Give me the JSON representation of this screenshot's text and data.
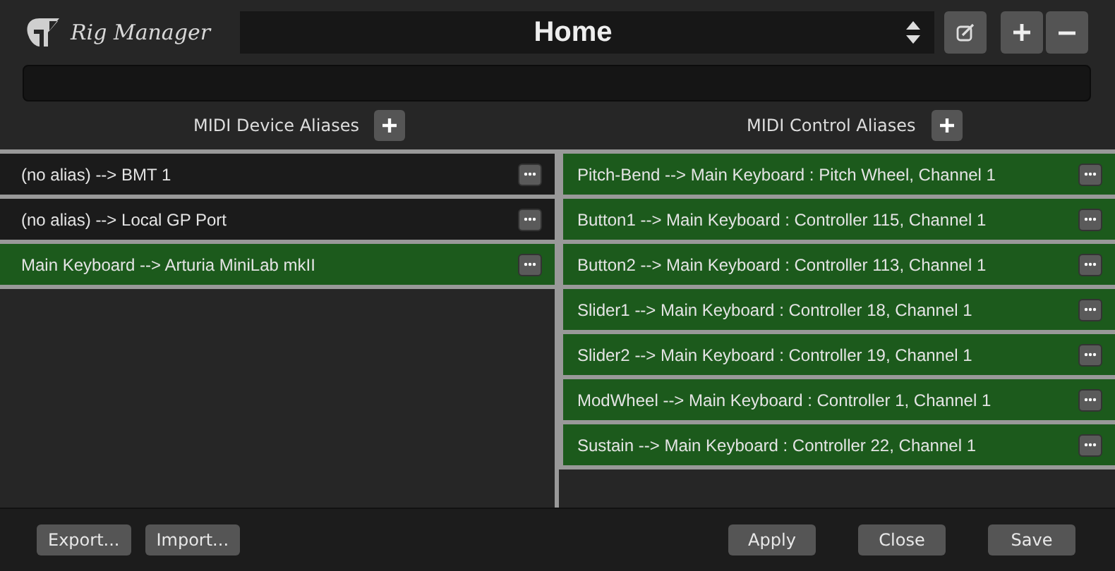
{
  "app": {
    "title": "Rig Manager"
  },
  "rig_selector": {
    "value": "Home"
  },
  "device_aliases": {
    "title": "MIDI Device Aliases",
    "rows": [
      {
        "label": "(no alias) --> BMT 1",
        "selected": false
      },
      {
        "label": "(no alias) --> Local GP Port",
        "selected": false
      },
      {
        "label": "Main Keyboard --> Arturia MiniLab mkII",
        "selected": true
      }
    ]
  },
  "control_aliases": {
    "title": "MIDI Control Aliases",
    "rows": [
      {
        "label": "Pitch-Bend --> Main Keyboard : Pitch Wheel, Channel 1",
        "selected": true
      },
      {
        "label": "Button1 --> Main Keyboard : Controller 115, Channel 1",
        "selected": true
      },
      {
        "label": "Button2 --> Main Keyboard : Controller 113, Channel 1",
        "selected": true
      },
      {
        "label": "Slider1 --> Main Keyboard : Controller 18, Channel 1",
        "selected": true
      },
      {
        "label": "Slider2 --> Main Keyboard : Controller 19, Channel 1",
        "selected": true
      },
      {
        "label": "ModWheel --> Main Keyboard : Controller 1, Channel 1",
        "selected": true
      },
      {
        "label": "Sustain --> Main Keyboard : Controller 22, Channel 1",
        "selected": true
      }
    ]
  },
  "footer": {
    "left_buttons": [
      "Export...",
      "Import..."
    ],
    "right_buttons": [
      "Apply",
      "Close",
      "Save"
    ]
  }
}
